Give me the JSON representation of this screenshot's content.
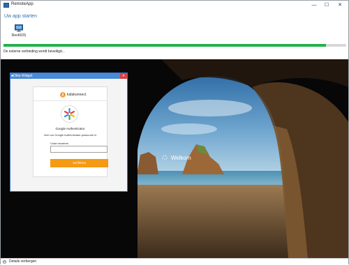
{
  "window": {
    "title": "RemoteApp",
    "controls": {
      "minimize": "—",
      "maximize": "☐",
      "close": "✕"
    }
  },
  "header": {
    "heading": "Uw app starten",
    "app_tile": {
      "label": "RexKIDS",
      "icon": "remote-app-icon"
    }
  },
  "connection": {
    "progress": 0.94,
    "status": "De externe verbinding wordt beveiligd..."
  },
  "desktop": {
    "welcome_text": "Welkom"
  },
  "okta_widget": {
    "title": "Okta Widget",
    "close_glyph": "✕",
    "brand": "kidskonnect",
    "authenticator": {
      "title": "Google Authenticator",
      "subtitle": "Voer uw Google Authenticator-passcode in",
      "code_label": "Code invoeren",
      "code_value": "",
      "verify_label": "Verifiëren"
    }
  },
  "footer": {
    "details_label": "Details verbergen",
    "icon": "chevron-up-icon"
  },
  "colors": {
    "accent_blue": "#2f6fb5",
    "progress_green": "#22b24c",
    "verify_orange": "#f59a13",
    "okta_bar": "#4a8ad6",
    "close_red": "#d64040"
  }
}
